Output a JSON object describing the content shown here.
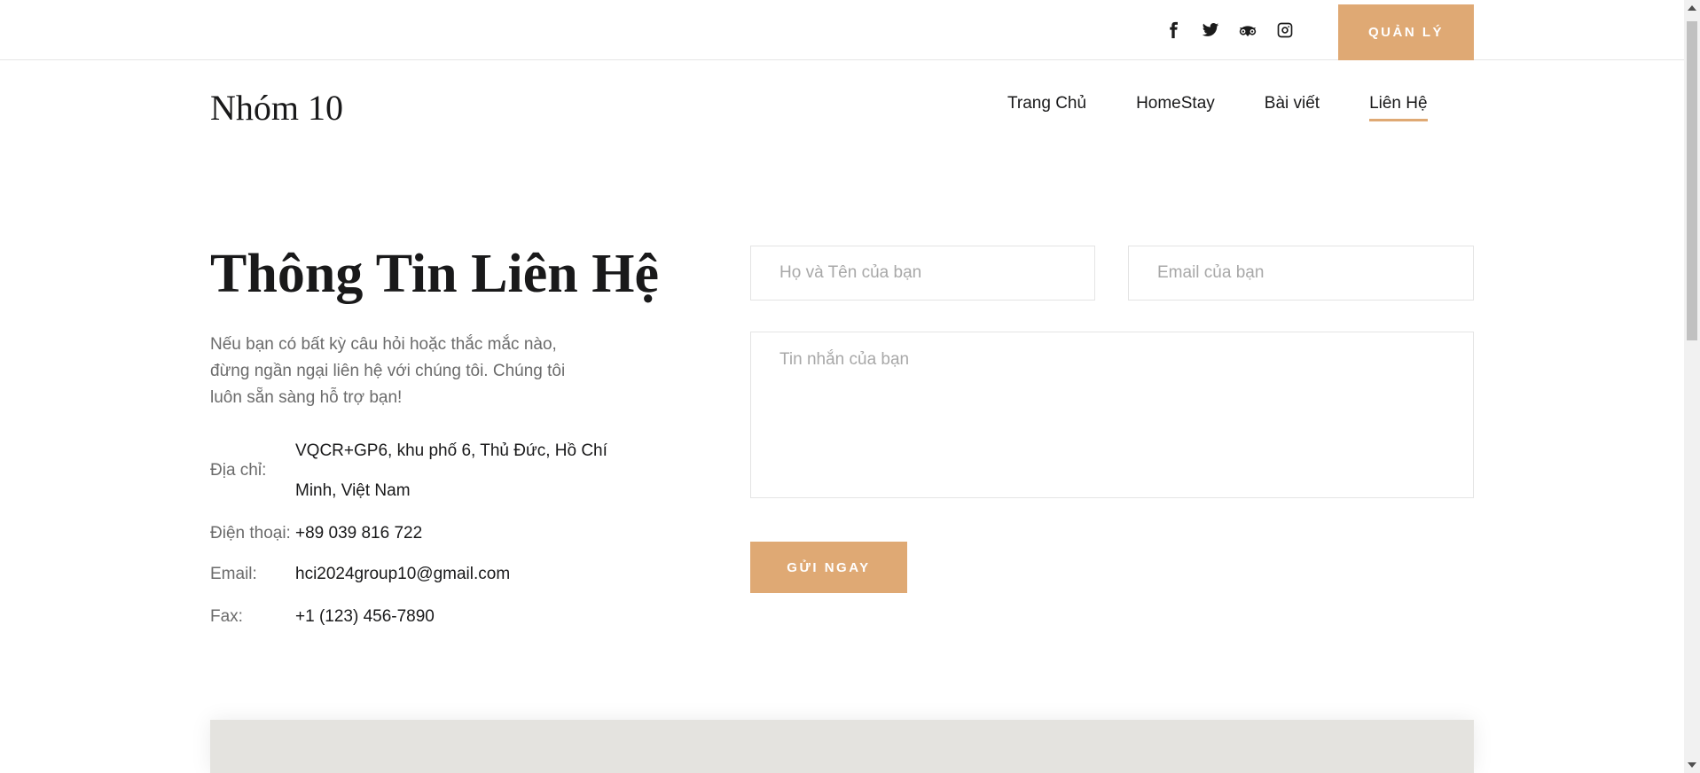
{
  "header": {
    "social_icons": [
      "facebook-icon",
      "twitter-icon",
      "tripadvisor-icon",
      "instagram-icon"
    ],
    "admin_button": "QUẢN LÝ"
  },
  "logo": "Nhóm 10",
  "nav": {
    "items": [
      "Trang Chủ",
      "HomeStay",
      "Bài viết",
      "Liên Hệ"
    ],
    "active": "Liên Hệ"
  },
  "contact": {
    "title": "Thông Tin Liên Hệ",
    "description": "Nếu bạn có bất kỳ câu hỏi hoặc thắc mắc nào, đừng ngần ngại liên hệ với chúng tôi. Chúng tôi luôn sẵn sàng hỗ trợ bạn!",
    "address_label": "Địa chỉ:",
    "address_value": "VQCR+GP6, khu phố 6, Thủ Đức, Hồ Chí Minh, Việt Nam",
    "phone_label": "Điện thoại:",
    "phone_value": "+89 039 816 722",
    "email_label": "Email:",
    "email_value": "hci2024group10@gmail.com",
    "fax_label": "Fax:",
    "fax_value": "+1 (123) 456-7890"
  },
  "form": {
    "name_placeholder": "Họ và Tên của bạn",
    "email_placeholder": "Email của bạn",
    "message_placeholder": "Tin nhắn của bạn",
    "submit_label": "GỬI NGAY"
  },
  "colors": {
    "accent": "#dfa974",
    "text_dark": "#19191a",
    "text_muted": "#6b6b6b",
    "map_bg": "#e4e3df"
  }
}
